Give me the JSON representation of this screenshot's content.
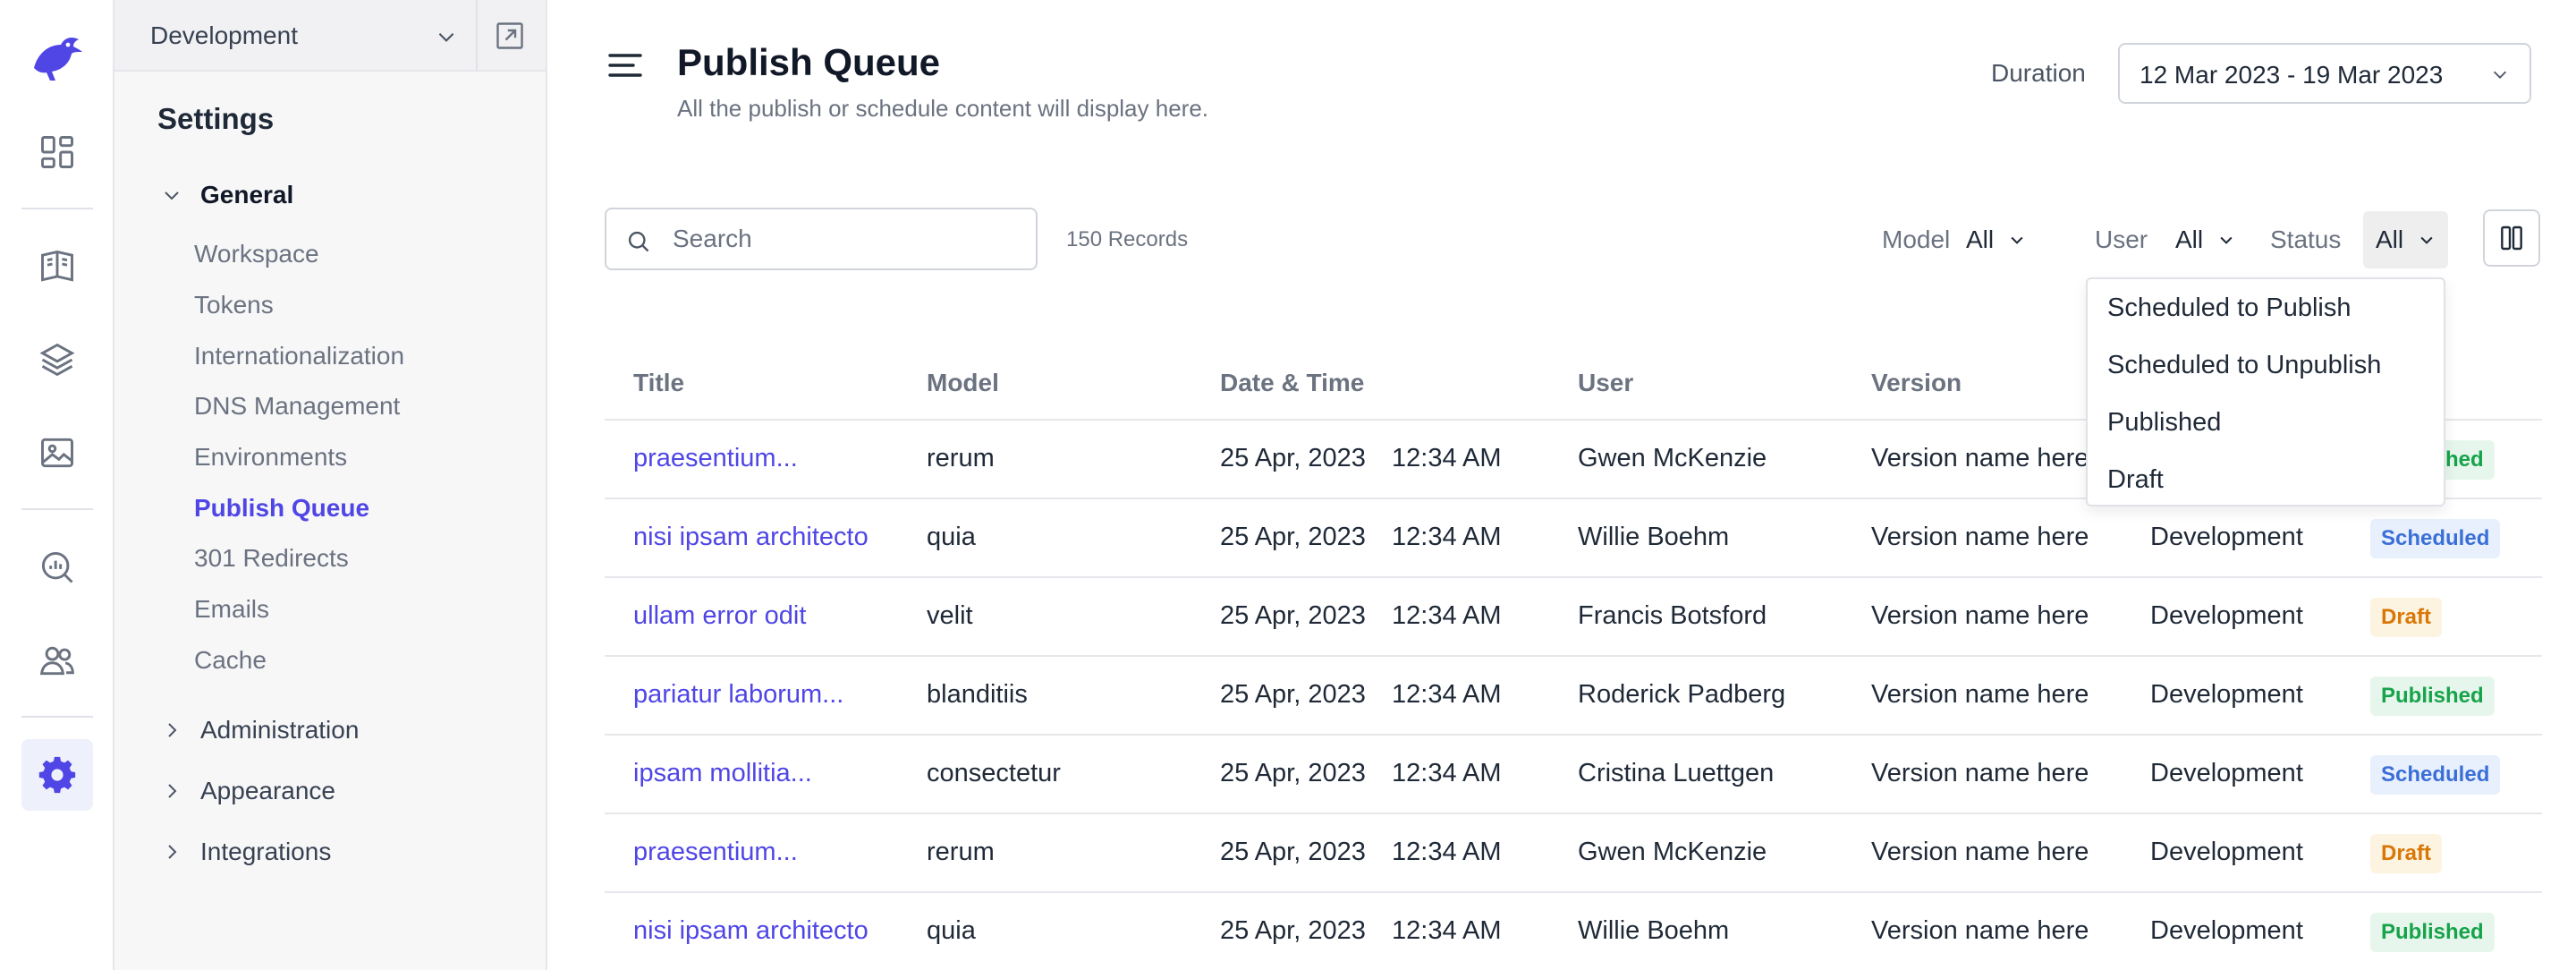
{
  "environment": {
    "name": "Development"
  },
  "sidebar": {
    "title": "Settings",
    "groups": [
      {
        "label": "General",
        "expanded": true,
        "items": [
          "Workspace",
          "Tokens",
          "Internationalization",
          "DNS Management",
          "Environments",
          "Publish Queue",
          "301 Redirects",
          "Emails",
          "Cache"
        ],
        "active": "Publish Queue"
      },
      {
        "label": "Administration",
        "expanded": false
      },
      {
        "label": "Appearance",
        "expanded": false
      },
      {
        "label": "Integrations",
        "expanded": false
      }
    ]
  },
  "header": {
    "title": "Publish Queue",
    "subtitle": "All the publish or schedule content will display here.",
    "duration_label": "Duration",
    "duration_value": "12 Mar 2023 - 19 Mar 2023"
  },
  "toolbar": {
    "search_placeholder": "Search",
    "records": "150 Records",
    "filters": [
      {
        "label": "Model",
        "value": "All"
      },
      {
        "label": "User",
        "value": "All"
      },
      {
        "label": "Status",
        "value": "All"
      }
    ]
  },
  "status_menu": [
    "Scheduled to Publish",
    "Scheduled to Unpublish",
    "Published",
    "Draft"
  ],
  "table": {
    "columns": [
      "Title",
      "Model",
      "Date & Time",
      "User",
      "Version"
    ],
    "rows": [
      {
        "title": "praesentium...",
        "model": "rerum",
        "date": "25 Apr, 2023",
        "time": "12:34 AM",
        "user": "Gwen McKenzie",
        "version": "Version name here",
        "env": "",
        "status": "Published"
      },
      {
        "title": "nisi ipsam architecto",
        "model": "quia",
        "date": "25 Apr, 2023",
        "time": "12:34 AM",
        "user": "Willie Boehm",
        "version": "Version name here",
        "env": "Development",
        "status": "Scheduled"
      },
      {
        "title": "ullam error odit",
        "model": "velit",
        "date": "25 Apr, 2023",
        "time": "12:34 AM",
        "user": "Francis Botsford",
        "version": "Version name here",
        "env": "Development",
        "status": "Draft"
      },
      {
        "title": "pariatur laborum...",
        "model": "blanditiis",
        "date": "25 Apr, 2023",
        "time": "12:34 AM",
        "user": "Roderick Padberg",
        "version": "Version name here",
        "env": "Development",
        "status": "Published"
      },
      {
        "title": "ipsam mollitia...",
        "model": "consectetur",
        "date": "25 Apr, 2023",
        "time": "12:34 AM",
        "user": "Cristina Luettgen",
        "version": "Version name here",
        "env": "Development",
        "status": "Scheduled"
      },
      {
        "title": "praesentium...",
        "model": "rerum",
        "date": "25 Apr, 2023",
        "time": "12:34 AM",
        "user": "Gwen McKenzie",
        "version": "Version name here",
        "env": "Development",
        "status": "Draft"
      },
      {
        "title": "nisi ipsam architecto",
        "model": "quia",
        "date": "25 Apr, 2023",
        "time": "12:34 AM",
        "user": "Willie Boehm",
        "version": "Version name here",
        "env": "Development",
        "status": "Published"
      }
    ]
  },
  "colors": {
    "accent": "#4f46e5",
    "published_bg": "#e7f6ec",
    "published_fg": "#16a34a",
    "scheduled_bg": "#e8f0fd",
    "scheduled_fg": "#3b6fd8",
    "draft_bg": "#fdf3e1",
    "draft_fg": "#d97706"
  },
  "icons": [
    "logo-bird-icon",
    "dashboard-icon",
    "book-icon",
    "layers-icon",
    "image-icon",
    "analytics-icon",
    "users-icon",
    "settings-gear-icon"
  ]
}
